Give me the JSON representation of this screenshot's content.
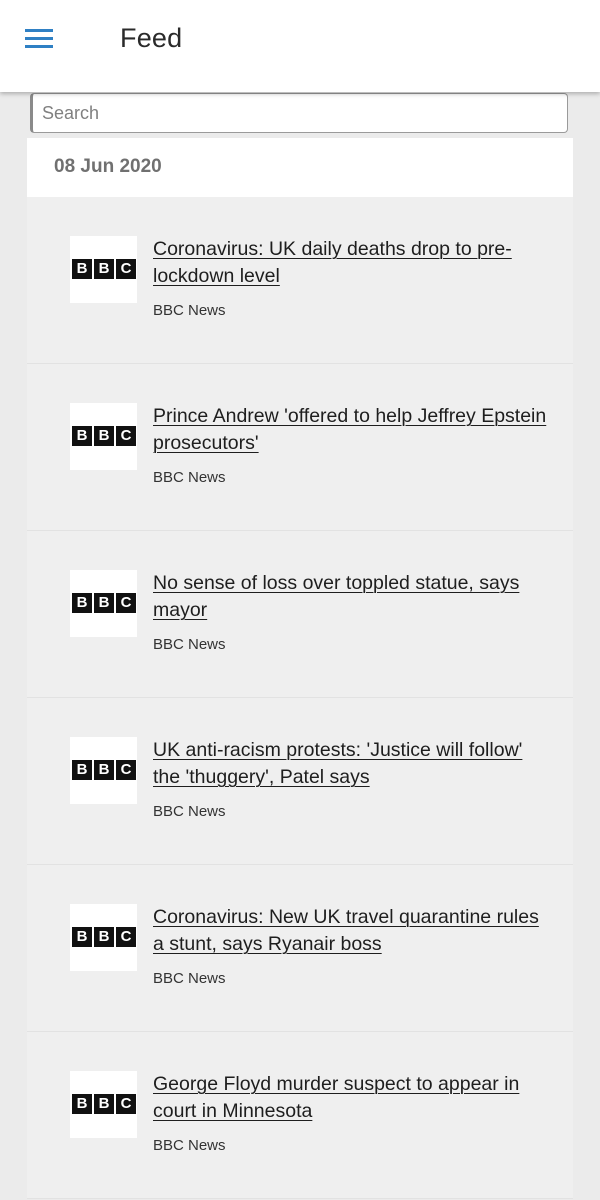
{
  "app_bar": {
    "title": "Feed",
    "menu_icon": "hamburger-menu-icon",
    "accent_color": "#2f80c4"
  },
  "search": {
    "placeholder": "Search",
    "value": ""
  },
  "feed": {
    "date": "08 Jun 2020",
    "items": [
      {
        "title": "Coronavirus: UK daily deaths drop to pre-lockdown level",
        "source": "BBC News",
        "logo": "bbc-logo",
        "logo_letters": [
          "B",
          "B",
          "C"
        ]
      },
      {
        "title": "Prince Andrew 'offered to help Jeffrey Epstein prosecutors'",
        "source": "BBC News",
        "logo": "bbc-logo",
        "logo_letters": [
          "B",
          "B",
          "C"
        ]
      },
      {
        "title": "No sense of loss over toppled statue, says mayor",
        "source": "BBC News",
        "logo": "bbc-logo",
        "logo_letters": [
          "B",
          "B",
          "C"
        ]
      },
      {
        "title": "UK anti-racism protests: 'Justice will follow' the 'thuggery', Patel says",
        "source": "BBC News",
        "logo": "bbc-logo",
        "logo_letters": [
          "B",
          "B",
          "C"
        ]
      },
      {
        "title": "Coronavirus: New UK travel quarantine rules a stunt, says Ryanair boss",
        "source": "BBC News",
        "logo": "bbc-logo",
        "logo_letters": [
          "B",
          "B",
          "C"
        ]
      },
      {
        "title": "George Floyd murder suspect to appear in court in Minnesota",
        "source": "BBC News",
        "logo": "bbc-logo",
        "logo_letters": [
          "B",
          "B",
          "C"
        ]
      }
    ]
  }
}
